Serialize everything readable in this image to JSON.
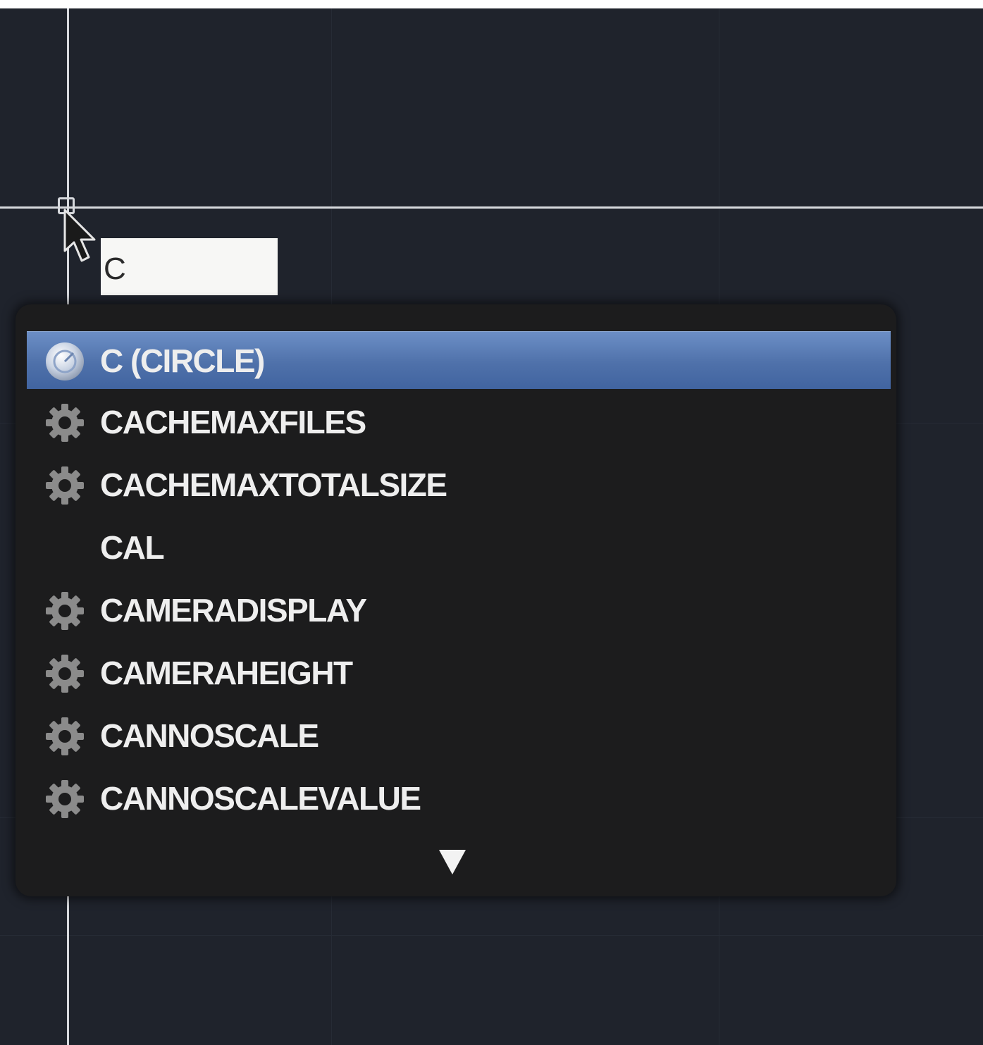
{
  "command_line": {
    "input_value": "C"
  },
  "autocomplete": {
    "items": [
      {
        "label": "C (CIRCLE)",
        "icon": "circle-command-icon",
        "selected": true
      },
      {
        "label": "CACHEMAXFILES",
        "icon": "gear-icon",
        "selected": false
      },
      {
        "label": "CACHEMAXTOTALSIZE",
        "icon": "gear-icon",
        "selected": false
      },
      {
        "label": "CAL",
        "icon": "none",
        "selected": false
      },
      {
        "label": "CAMERADISPLAY",
        "icon": "gear-icon",
        "selected": false
      },
      {
        "label": "CAMERAHEIGHT",
        "icon": "gear-icon",
        "selected": false
      },
      {
        "label": "CANNOSCALE",
        "icon": "gear-icon",
        "selected": false
      },
      {
        "label": "CANNOSCALEVALUE",
        "icon": "gear-icon",
        "selected": false
      }
    ],
    "scroll_icon": "triangle-down-icon"
  },
  "colors": {
    "canvas_background": "#1f232c",
    "crosshair": "#d7d9dd",
    "dropdown_background": "#1c1c1d",
    "selection": "#4f71aa",
    "item_text": "#eeeeee"
  }
}
